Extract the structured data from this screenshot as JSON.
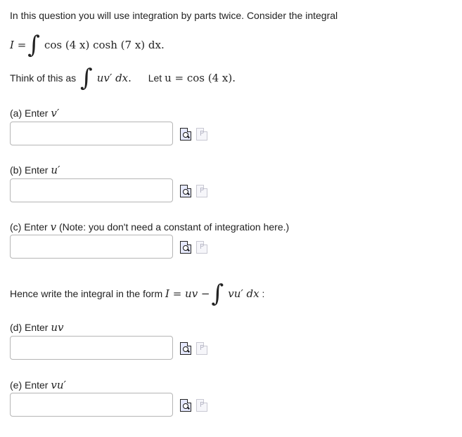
{
  "intro": {
    "text": "In this question you will use integration by parts twice. Consider the integral",
    "integral_lhs": "I =",
    "integral_symbol": "∫",
    "integrand": "cos (4 x) cosh (7 x) dx",
    "end": "."
  },
  "think": {
    "prefix": "Think of this as",
    "integral_symbol": "∫",
    "expr": "uv′ dx",
    "end": ".",
    "let_label": "Let",
    "let_expr": "u = cos (4 x)",
    "let_end": "."
  },
  "parts": {
    "a": {
      "label": "(a) Enter",
      "var": "v′",
      "note": "",
      "value": ""
    },
    "b": {
      "label": "(b) Enter",
      "var": "u′",
      "note": "",
      "value": ""
    },
    "c": {
      "label": "(c) Enter",
      "var": "v",
      "note": "(Note: you don't need a constant of integration here.)",
      "value": ""
    },
    "d": {
      "label": "(d) Enter",
      "var": "uv",
      "note": "",
      "value": ""
    },
    "e": {
      "label": "(e) Enter",
      "var": "vu′",
      "note": "",
      "value": ""
    }
  },
  "hence": {
    "prefix": "Hence write the integral in the form",
    "form": "I = uv −",
    "integral_symbol": "∫",
    "expr": "vu′ dx",
    "end": ":"
  },
  "icons": {
    "preview": "preview-magnifier-icon",
    "help": "help-document-icon",
    "help_glyph": "P"
  }
}
